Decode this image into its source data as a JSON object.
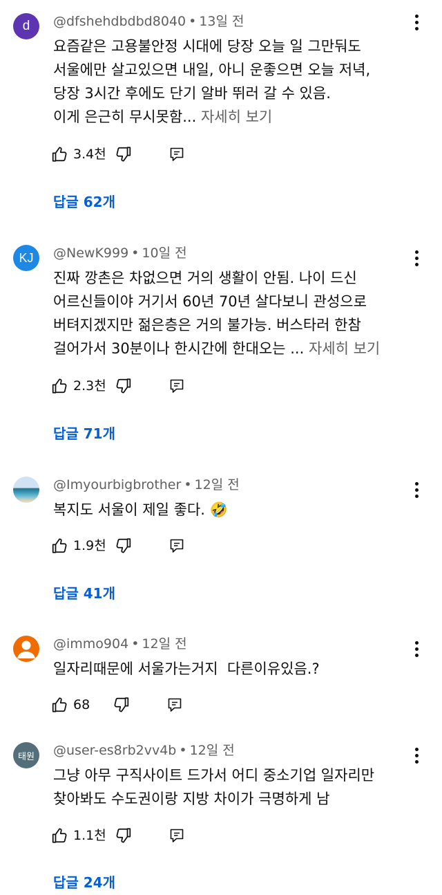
{
  "comments": [
    {
      "avatar_text": "d",
      "avatar_color": "#5e35b1",
      "author": "@dfshehdbdbd8040",
      "time": "13일 전",
      "lines": [
        "요즘같은 고용불안정 시대에 당장 오늘 일 그만둬도",
        "서울에만 살고있으면 내일, 아니 운좋으면 오늘 저녁,",
        "당장 3시간 후에도 단기 알바 뛰러 갈 수 있음.",
        "이게 은근히 무시못함... "
      ],
      "read_more": "자세히 보기",
      "likes": "3.4천",
      "replies": "답글 62개"
    },
    {
      "avatar_text": "KJ",
      "avatar_color": "#1e88e5",
      "author": "@NewK999",
      "time": "10일 전",
      "lines": [
        "진짜 깡촌은 차없으면 거의 생활이 안됨. 나이 드신",
        "어르신들이야 거기서 60년 70년 살다보니 관성으로",
        "버텨지겠지만 젊은층은 거의 불가능. 버스타러 한참",
        "걸어가서 30분이나 한시간에 한대오는 ... "
      ],
      "read_more": "자세히 보기",
      "likes": "2.3천",
      "replies": "답글 71개"
    },
    {
      "avatar_text": "",
      "avatar_color": "#7fa6c8",
      "author": "@Imyourbigbrother",
      "time": "12일 전",
      "lines": [
        "복지도 서울이 제일 좋다. 🤣"
      ],
      "read_more": "",
      "likes": "1.9천",
      "replies": "답글 41개"
    },
    {
      "avatar_text": "",
      "avatar_color": "#ef6c00",
      "author": "@immo904",
      "time": "12일 전",
      "lines": [
        "일자리때문에 서울가는거지  다른이유있음.?"
      ],
      "read_more": "",
      "likes": "68",
      "replies": ""
    },
    {
      "avatar_text": "태원",
      "avatar_color": "#546e7a",
      "author": "@user-es8rb2vv4b",
      "time": "12일 전",
      "lines": [
        "그냥 아무 구직사이트 드가서 어디 중소기업 일자리만",
        "찾아봐도 수도권이랑 지방 차이가 극명하게 남"
      ],
      "read_more": "",
      "likes": "1.1천",
      "replies": "답글 24개"
    }
  ],
  "separator": "•",
  "colors": {
    "link_blue": "#065fd4",
    "secondary_text": "#606060",
    "primary_text": "#0f0f0f"
  },
  "icons": {
    "like": "thumb-up-icon",
    "dislike": "thumb-down-icon",
    "reply": "reply-comment-icon",
    "menu": "more-vert-icon"
  }
}
